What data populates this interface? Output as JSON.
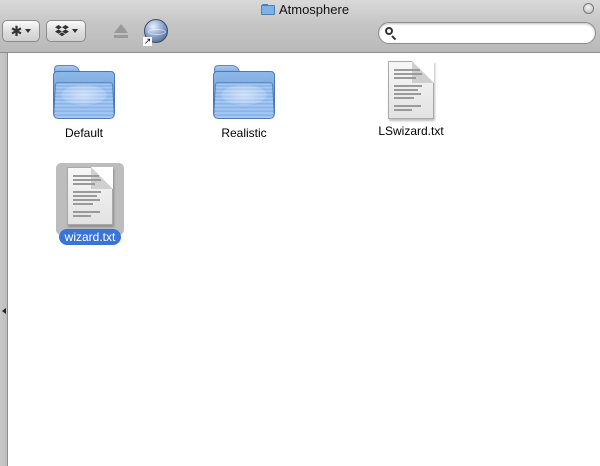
{
  "window": {
    "title": "Atmosphere"
  },
  "toolbar": {
    "action_button_icon": "gear-icon",
    "dropbox_button_icon": "dropbox-icon",
    "eject_icon": "eject-icon",
    "network_icon": "network-globe-icon",
    "search": {
      "value": "",
      "placeholder": ""
    }
  },
  "colors": {
    "selection": "#3875d7",
    "selection_icon_bg": "#bdbdbd"
  },
  "files": [
    {
      "name": "Default",
      "kind": "folder",
      "selected": false
    },
    {
      "name": "Realistic",
      "kind": "folder",
      "selected": false
    },
    {
      "name": "LSwizard.txt",
      "kind": "text-document",
      "selected": false
    },
    {
      "name": "wizard.txt",
      "kind": "text-document",
      "selected": true
    }
  ]
}
